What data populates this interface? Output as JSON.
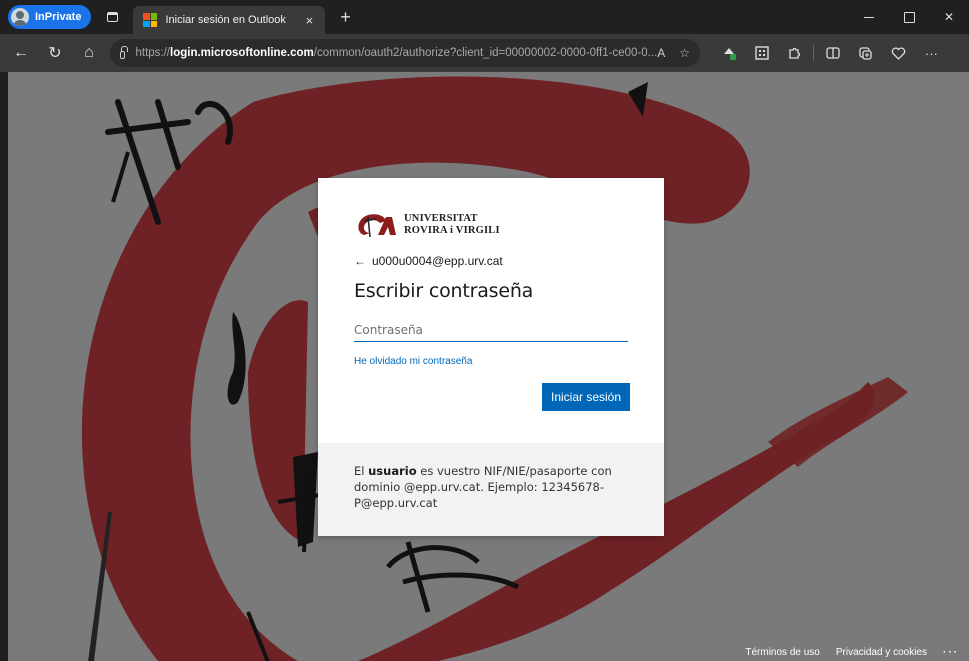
{
  "browser": {
    "inprivate_label": "InPrivate",
    "tab": {
      "title": "Iniciar sesión en Outlook",
      "close_glyph": "×"
    },
    "new_tab_glyph": "+",
    "window_controls": {
      "close_glyph": "✕"
    },
    "address": {
      "scheme": "https://",
      "host": "login.microsoftonline.com",
      "path": "/common/oauth2/authorize?client_id=00000002-0000-0ff1-ce00-0..."
    },
    "icons": {
      "back": "←",
      "refresh": "↻",
      "home": "⌂",
      "read_aloud": "A",
      "favorite": "☆",
      "more": "···"
    }
  },
  "brand": {
    "line1": "UNIVERSITAT",
    "line2": "ROVIRA i VIRGILI",
    "colors": {
      "mark": "#8b1d1d",
      "accent": "#0067b8"
    }
  },
  "login": {
    "identity": "u000u0004@epp.urv.cat",
    "back_glyph": "←",
    "heading": "Escribir contraseña",
    "password_placeholder": "Contraseña",
    "forgot_link": "He olvidado mi contraseña",
    "signin_button": "Iniciar sesión"
  },
  "hint": {
    "prefix": "El ",
    "bold": "usuario",
    "rest": " es vuestro NIF/NIE/pasaporte con dominio @epp.urv.cat. Ejemplo: 12345678-P@epp.urv.cat"
  },
  "page_footer": {
    "terms": "Términos de uso",
    "privacy": "Privacidad y cookies",
    "more": "···"
  }
}
